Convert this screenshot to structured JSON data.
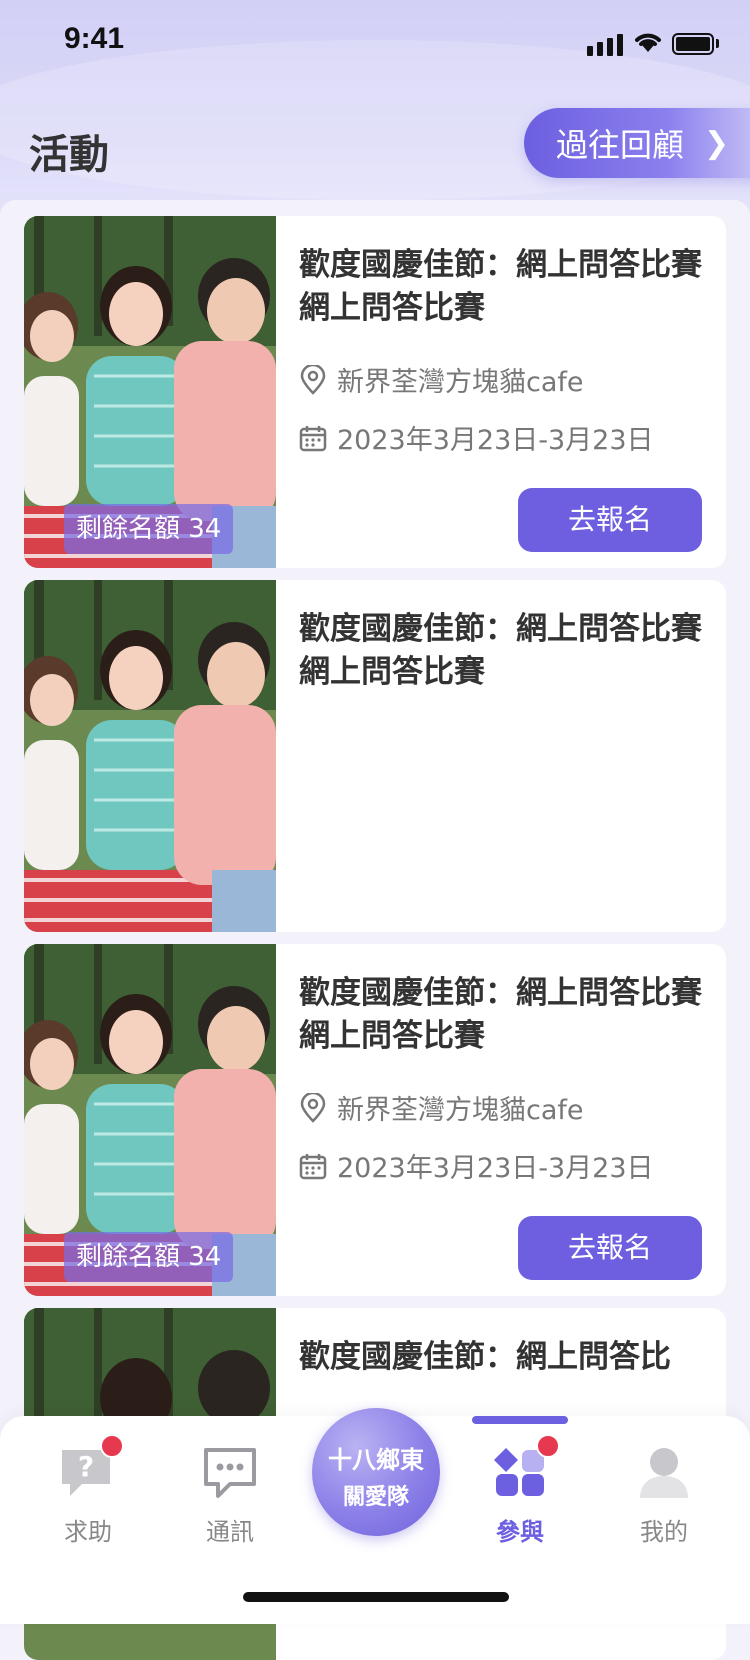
{
  "status_bar": {
    "time": "9:41"
  },
  "header": {
    "title": "活動",
    "history_button": "過往回顧"
  },
  "activities": [
    {
      "title": "歡度國慶佳節：網上問答比賽網上問答比賽",
      "quota": "剩餘名額 34",
      "location": "新界荃灣方塊貓cafe",
      "date": "2023年3月23日-3月23日",
      "button": "去報名",
      "image": "family-picnic-photo"
    },
    {
      "title": "歡度國慶佳節：網上問答比賽網上問答比賽",
      "image": "family-picnic-photo"
    },
    {
      "title": "歡度國慶佳節：網上問答比賽網上問答比賽",
      "quota": "剩餘名額 34",
      "location": "新界荃灣方塊貓cafe",
      "date": "2023年3月23日-3月23日",
      "button": "去報名",
      "image": "family-picnic-photo"
    },
    {
      "title": "歡度國慶佳節：網上問答比",
      "image": "family-picnic-photo"
    }
  ],
  "tabbar": {
    "items": [
      {
        "label": "求助",
        "icon": "help-icon",
        "badge": true
      },
      {
        "label": "通訊",
        "icon": "chat-icon"
      },
      {
        "label": "參與",
        "icon": "participate-icon",
        "badge": true,
        "active": true
      },
      {
        "label": "我的",
        "icon": "profile-icon"
      }
    ],
    "center_logo": {
      "line1": "十八鄉東",
      "line2": "關愛隊"
    }
  },
  "colors": {
    "accent": "#6c5fe0",
    "badge": "#e63950"
  }
}
